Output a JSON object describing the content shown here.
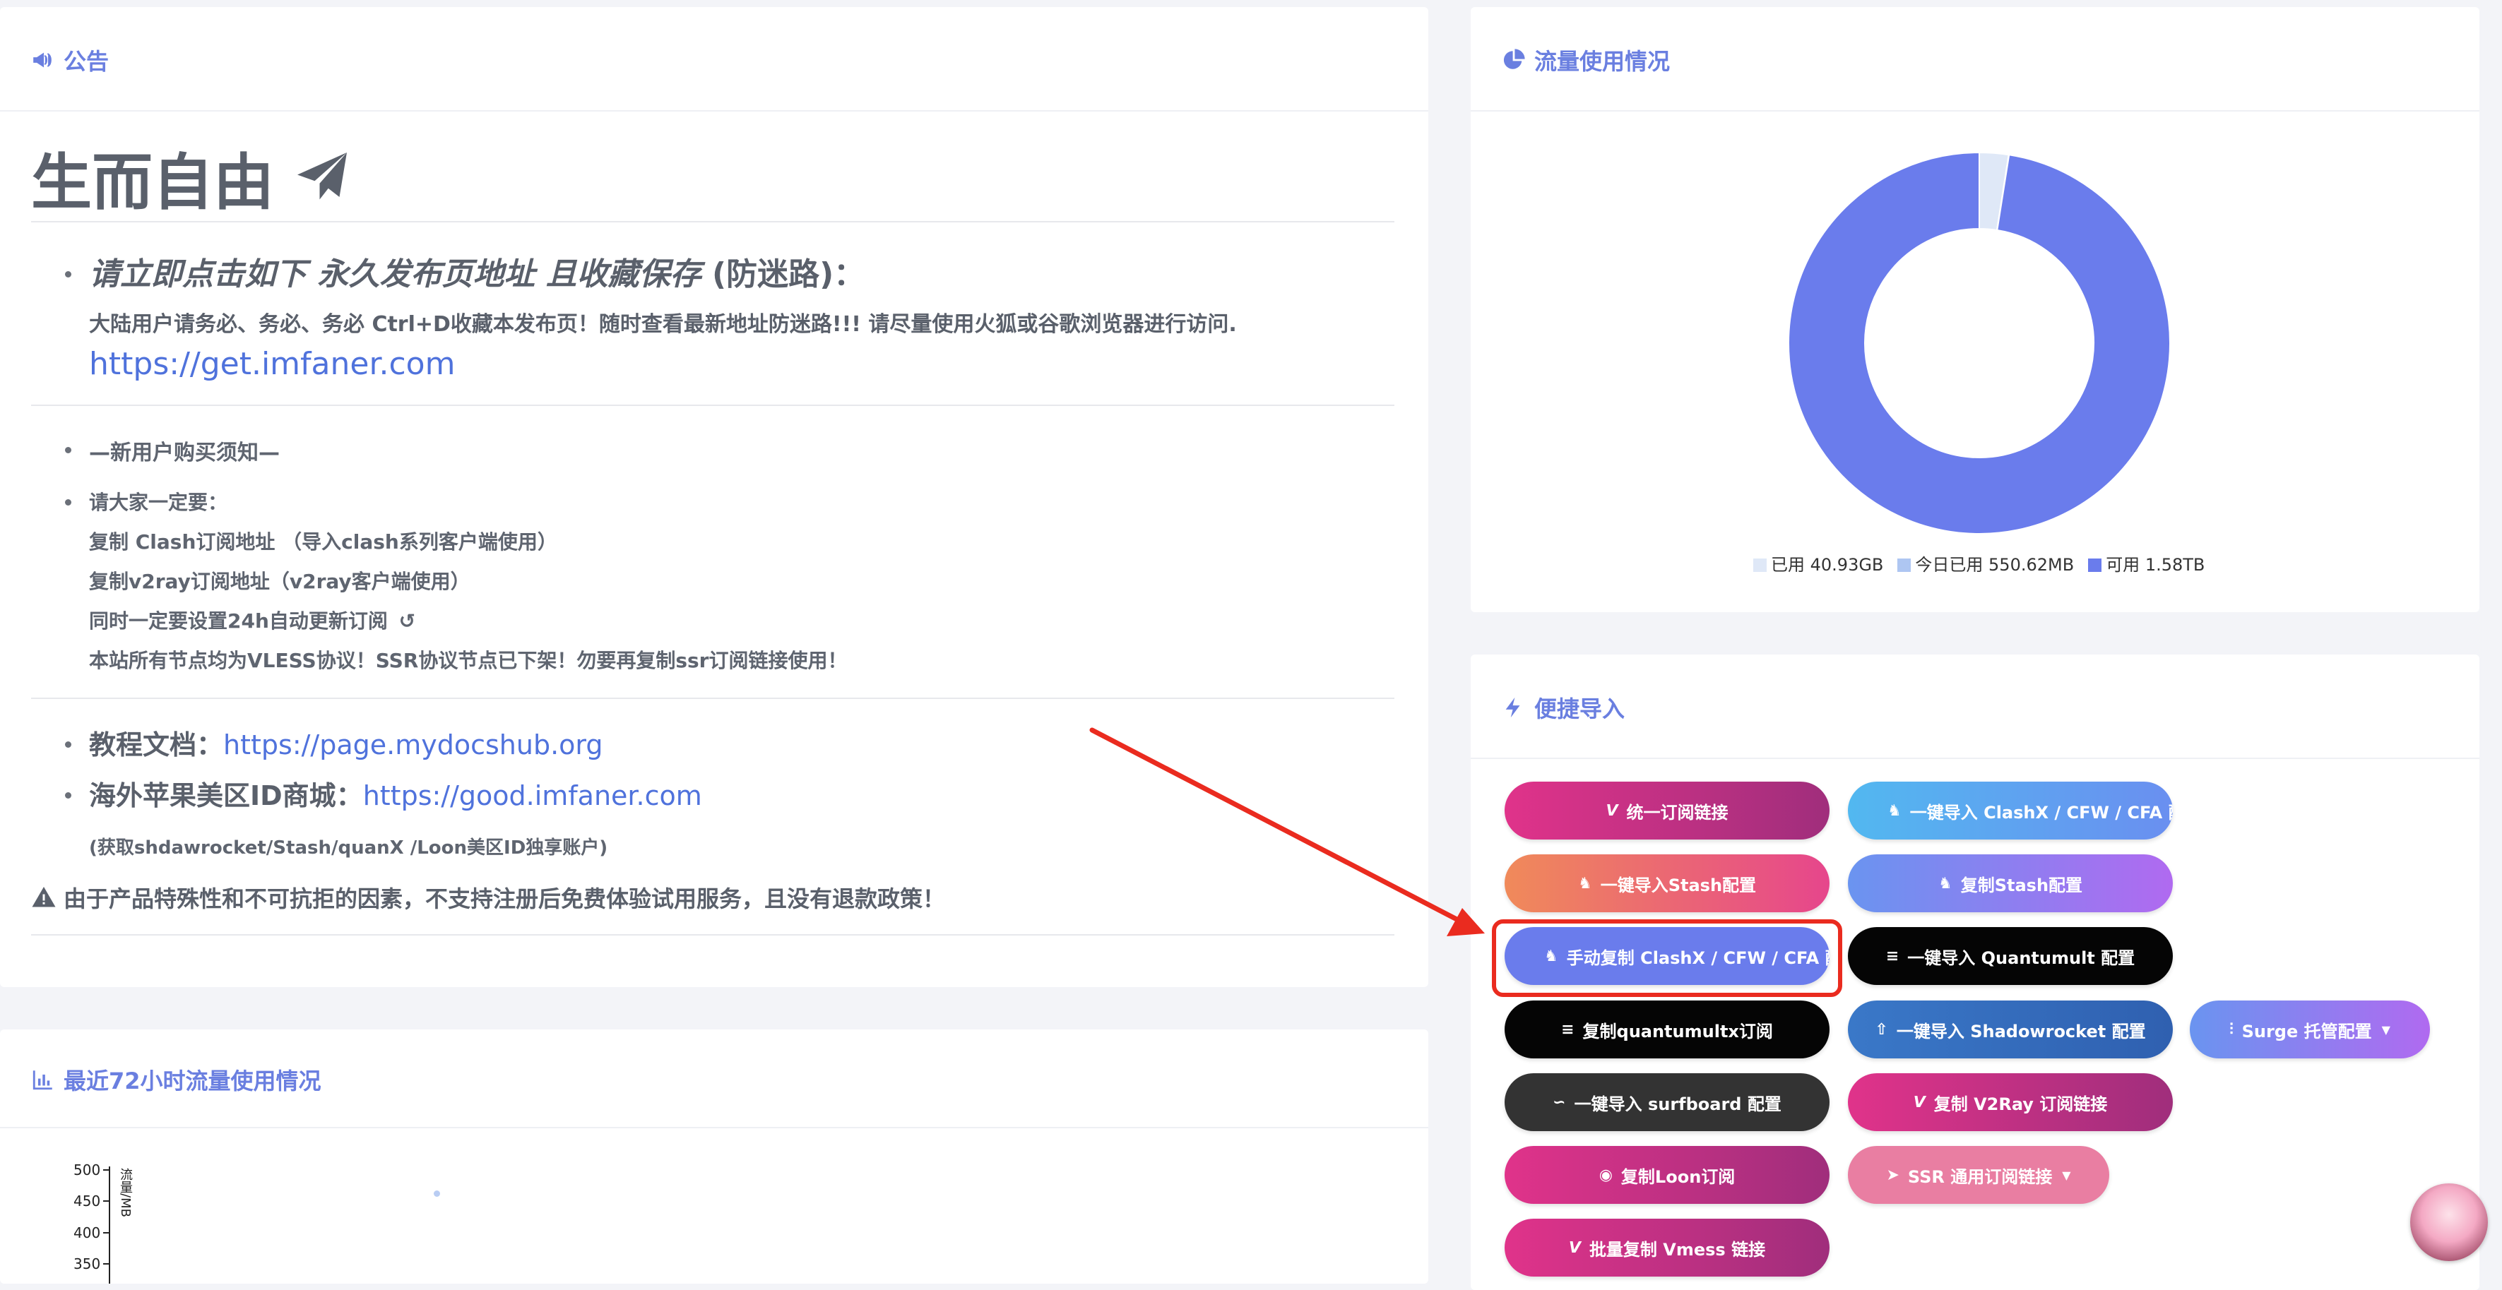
{
  "announcement": {
    "title": "公告",
    "heading": "生而自由",
    "section1": {
      "lead_italic": "请立即点击如下 永久发布页地址 且收藏保存",
      "lead_suffix": "(防迷路)：",
      "note": "大陆用户请务必、务必、务必 Ctrl+D收藏本发布页！随时查看最新地址防迷路!!! 请尽量使用火狐或谷歌浏览器进行访问.",
      "url": "https://get.imfaner.com"
    },
    "section2": {
      "item1": "—新用户购买须知—",
      "item2": "请大家一定要：",
      "line1": "复制 Clash订阅地址 （导入clash系列客户端使用）",
      "line2": "复制v2ray订阅地址（v2ray客户端使用）",
      "line3": "同时一定要设置24h自动更新订阅",
      "line4": "本站所有节点均为VLESS协议！SSR协议节点已下架！勿要再复制ssr订阅链接使用！"
    },
    "section3": {
      "docs_label": "教程文档：",
      "docs_url": "https://page.mydocshub.org",
      "store_label": "海外苹果美区ID商城：",
      "store_url": "https://good.imfaner.com",
      "store_note": "(获取shdawrocket/Stash/quanX /Loon美区ID独享账户)"
    },
    "warning": "由于产品特殊性和不可抗拒的因素，不支持注册后免费体验试用服务，且没有退款政策！"
  },
  "traffic72h": {
    "title": "最近72小时流量使用情况",
    "ylabel": "流量/MB",
    "ticks": [
      "500",
      "450",
      "400",
      "350"
    ]
  },
  "usage": {
    "title": "流量使用情况",
    "legend": [
      "已用 40.93GB",
      "今日已用 550.62MB",
      "可用 1.58TB"
    ]
  },
  "chart_data": {
    "type": "pie",
    "categories": [
      "已用",
      "今日已用",
      "可用"
    ],
    "values": [
      40.93,
      0.55,
      1617.92
    ],
    "units": "GB",
    "colors": [
      "#dfe8f7",
      "#aec6f2",
      "#6a7cec"
    ],
    "legend_position": "bottom"
  },
  "quick_import": {
    "title": "便捷导入",
    "buttons": [
      {
        "label": "统一订阅链接",
        "icon": "v-icon"
      },
      {
        "label": "一键导入 ClashX / CFW / CFA 配置",
        "icon": "cat-icon"
      },
      {
        "label": "一键导入Stash配置",
        "icon": "cat-icon"
      },
      {
        "label": "复制Stash配置",
        "icon": "cat-icon"
      },
      {
        "label": "手动复制 ClashX / CFW / CFA 配置",
        "icon": "cat-icon"
      },
      {
        "label": "一键导入 Quantumult 配置",
        "icon": "quantumult-icon"
      },
      {
        "label": "复制quantumultx订阅",
        "icon": "quantumult-icon"
      },
      {
        "label": "一键导入 Shadowrocket 配置",
        "icon": "rocket-icon"
      },
      {
        "label": "Surge 托管配置",
        "icon": "surge-icon"
      },
      {
        "label": "一键导入 surfboard 配置",
        "icon": "surfboard-icon"
      },
      {
        "label": "复制 V2Ray 订阅链接",
        "icon": "v-icon"
      },
      {
        "label": "复制Loon订阅",
        "icon": "loon-icon"
      },
      {
        "label": "SSR 通用订阅链接",
        "icon": "paper-plane-icon"
      },
      {
        "label": "批量复制 Vmess 链接",
        "icon": "v-icon"
      }
    ]
  }
}
